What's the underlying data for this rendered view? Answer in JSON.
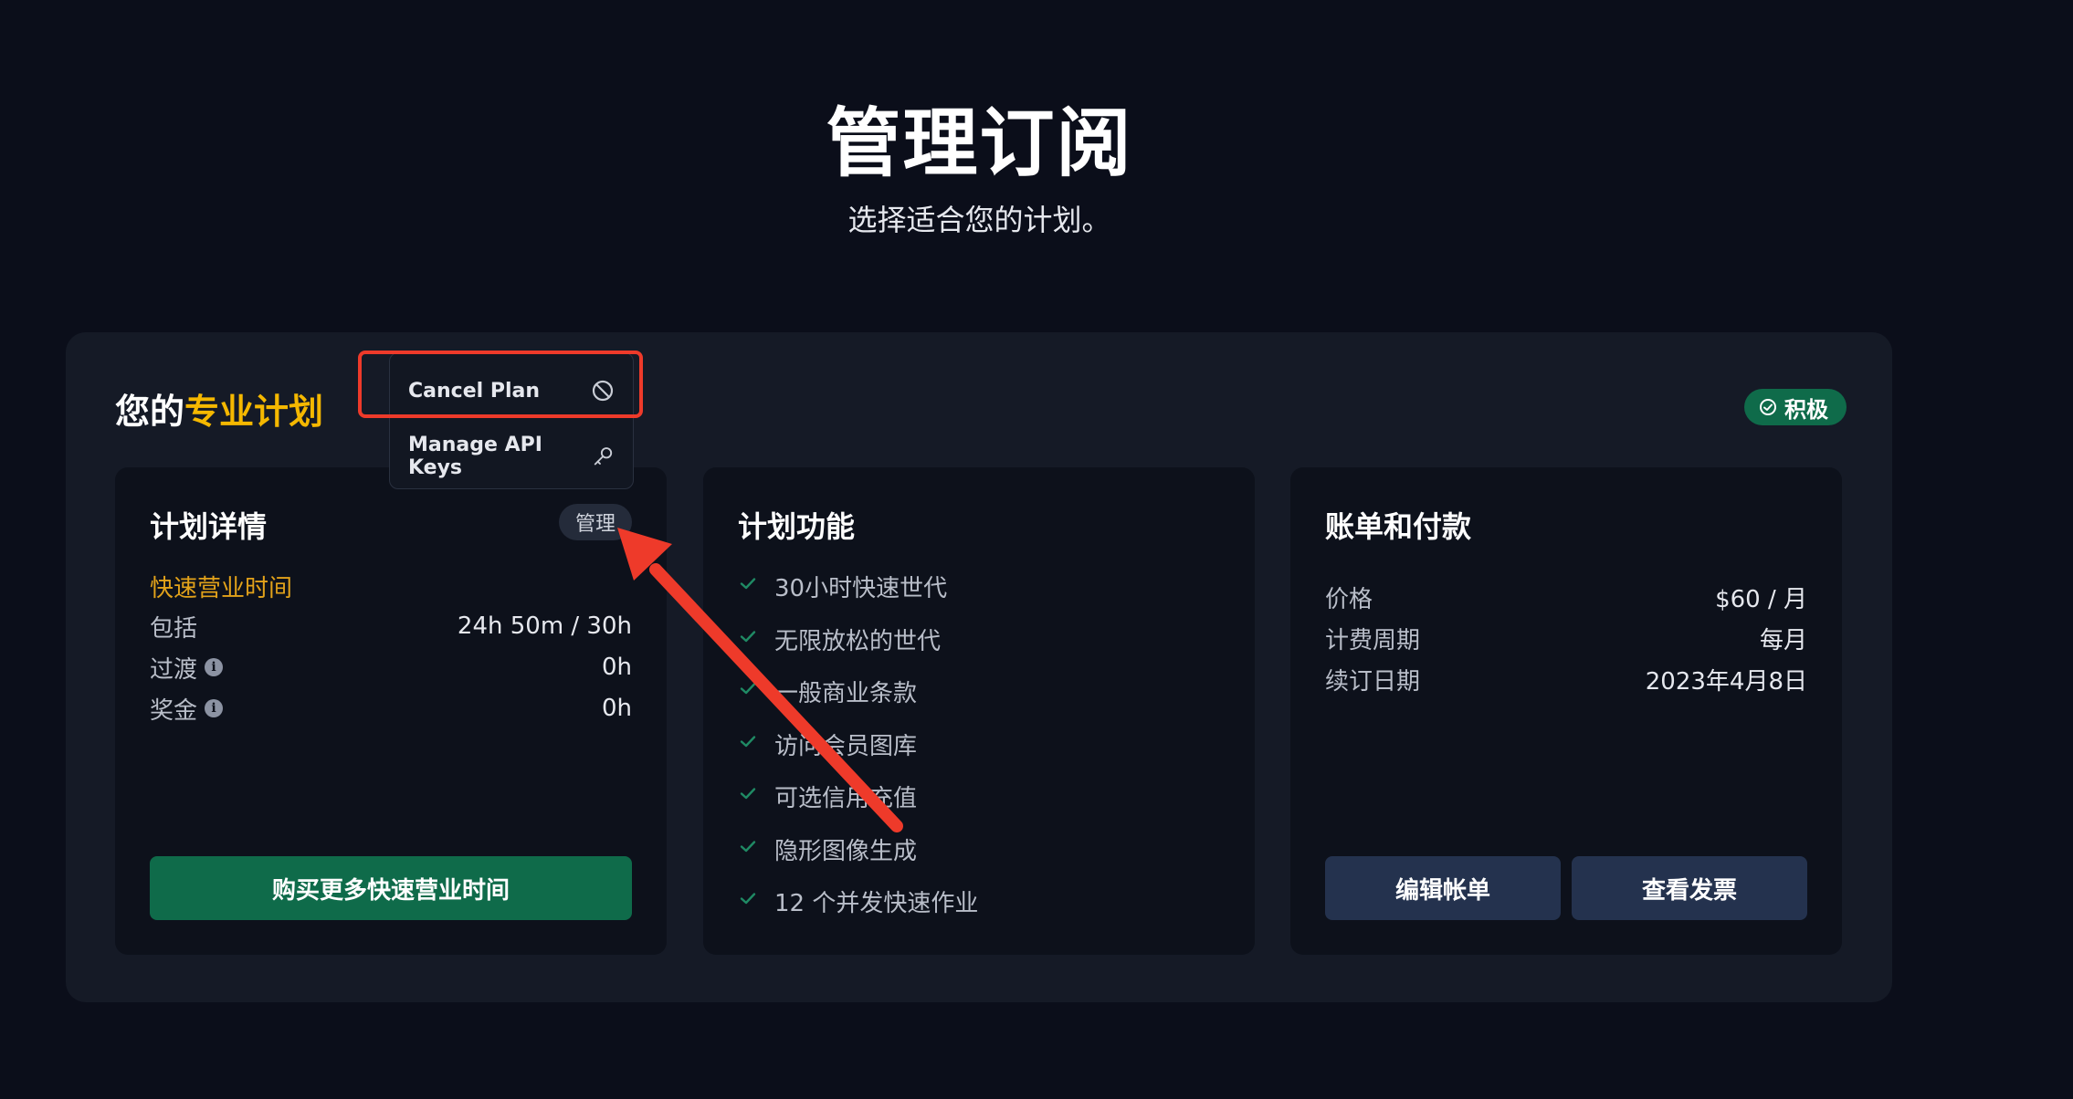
{
  "header": {
    "title": "管理订阅",
    "subtitle": "选择适合您的计划。"
  },
  "plan": {
    "heading_prefix": "您的",
    "heading_accent": "专业计划",
    "status_badge": "积极"
  },
  "dropdown": {
    "items": [
      {
        "label": "Cancel Plan",
        "icon": "ban-icon"
      },
      {
        "label": "Manage API Keys",
        "icon": "key-icon"
      }
    ]
  },
  "details": {
    "title": "计划详情",
    "manage_label": "管理",
    "hours_label": "快速营业时间",
    "rows": [
      {
        "key": "包括",
        "value": "24h 50m / 30h",
        "info": false
      },
      {
        "key": "过渡",
        "value": "0h",
        "info": true
      },
      {
        "key": "奖金",
        "value": "0h",
        "info": true
      }
    ],
    "buy_button": "购买更多快速营业时间"
  },
  "features": {
    "title": "计划功能",
    "items": [
      "30小时快速世代",
      "无限放松的世代",
      "一般商业条款",
      "访问会员图库",
      "可选信用充值",
      "隐形图像生成",
      "12 个并发快速作业"
    ]
  },
  "billing": {
    "title": "账单和付款",
    "rows": [
      {
        "key": "价格",
        "value": "$60 / 月"
      },
      {
        "key": "计费周期",
        "value": "每月"
      },
      {
        "key": "续订日期",
        "value": "2023年4月8日"
      }
    ],
    "edit_button": "编辑帐单",
    "invoice_button": "查看发票"
  },
  "colors": {
    "accent_yellow": "#f5b800",
    "green": "#0f6b4a",
    "highlight_red": "#ee3a2a"
  }
}
